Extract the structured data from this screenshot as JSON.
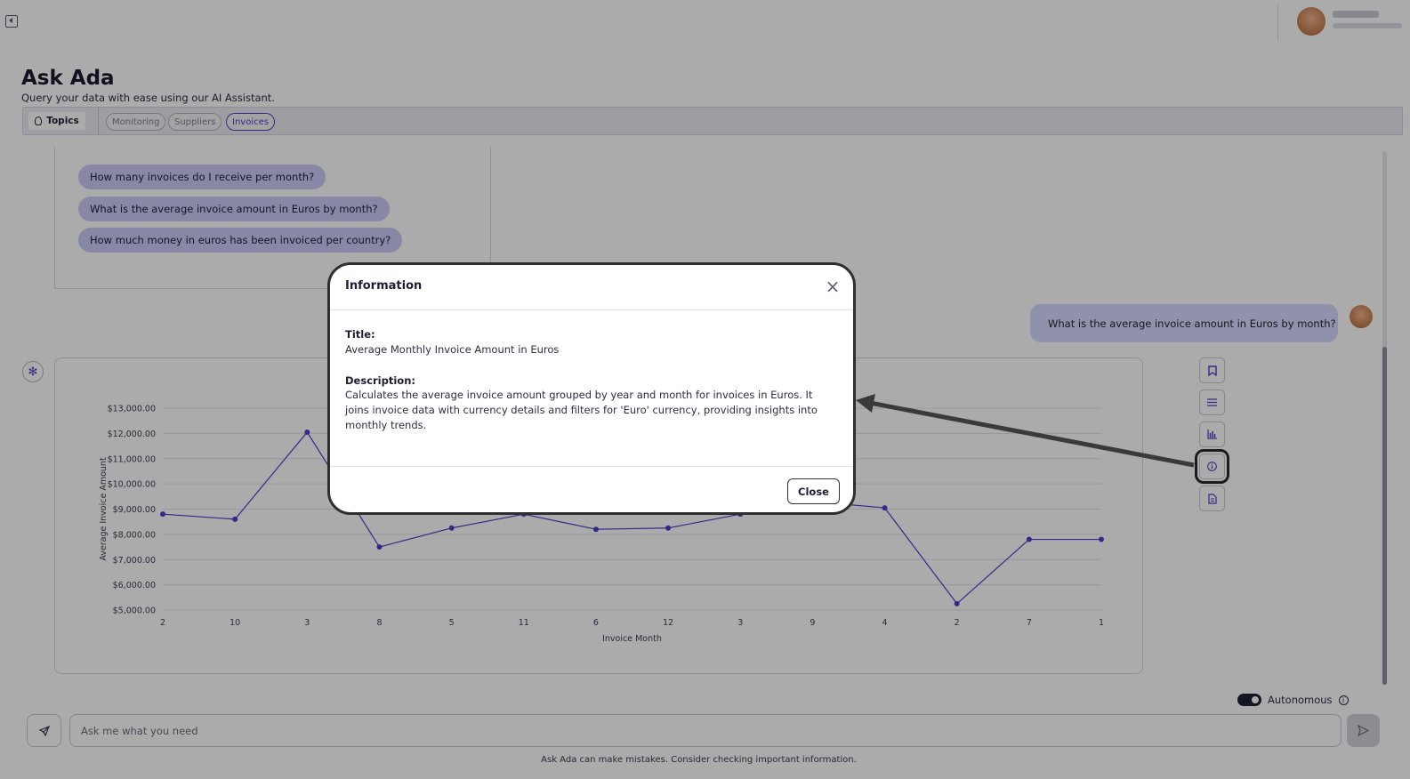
{
  "header": {
    "title": "Ask Ada",
    "subtitle": "Query your data with ease using our AI Assistant."
  },
  "topics": {
    "button_label": "Topics",
    "items": [
      {
        "label": "Monitoring",
        "active": false
      },
      {
        "label": "Suppliers",
        "active": false
      },
      {
        "label": "Invoices",
        "active": true
      }
    ]
  },
  "suggestions": [
    "How many invoices do I receive per month?",
    "What is the average invoice amount in Euros by month?",
    "How much money in euros has been invoiced per country?"
  ],
  "user_message": "What is the average invoice amount in Euros by month?",
  "chart_data": {
    "type": "line",
    "title": "",
    "xlabel": "Invoice Month",
    "ylabel": "Average Invoice Amount",
    "categories": [
      "2",
      "10",
      "3",
      "8",
      "5",
      "11",
      "6",
      "12",
      "3",
      "9",
      "4",
      "2",
      "7",
      "1"
    ],
    "y_ticks": [
      "$5,000.00",
      "$6,000.00",
      "$7,000.00",
      "$8,000.00",
      "$9,000.00",
      "$10,000.00",
      "$11,000.00",
      "$12,000.00",
      "$13,000.00"
    ],
    "ylim": [
      5000,
      13000
    ],
    "grid": true,
    "color": "#4b3fc9",
    "series": [
      {
        "values": [
          8800,
          8600,
          12050,
          7500,
          8250,
          8800,
          8200,
          8250,
          8800,
          9300,
          9050,
          5250,
          7800,
          7800
        ]
      }
    ]
  },
  "actions": [
    {
      "icon": "bookmark-icon"
    },
    {
      "icon": "list-icon"
    },
    {
      "icon": "bar-chart-icon"
    },
    {
      "icon": "info-icon"
    },
    {
      "icon": "document-icon"
    }
  ],
  "autonomous_label": "Autonomous",
  "composer": {
    "placeholder": "Ask me what you need"
  },
  "disclaimer": "Ask Ada can make mistakes. Consider checking important information.",
  "modal": {
    "title": "Information",
    "title_label": "Title:",
    "title_value": "Average Monthly Invoice Amount in Euros",
    "description_label": "Description:",
    "description_value": "Calculates the average invoice amount grouped by year and month for invoices in Euros. It joins invoice data with currency details and filters for 'Euro' currency, providing insights into monthly trends.",
    "close_label": "Close"
  }
}
